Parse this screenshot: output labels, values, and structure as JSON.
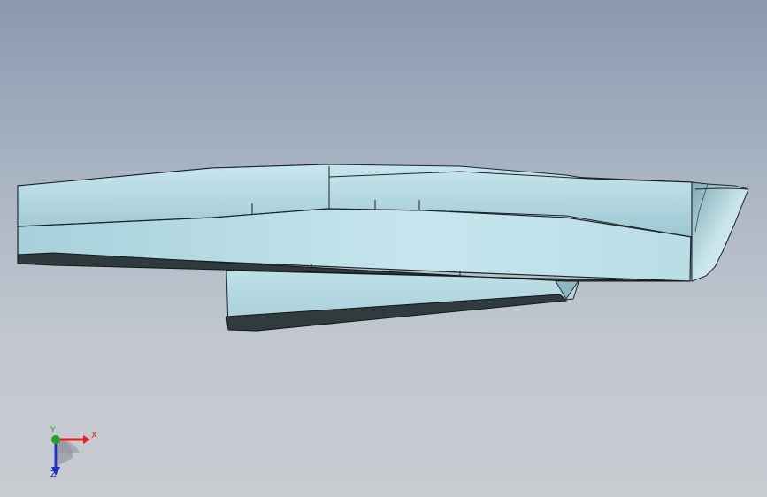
{
  "viewport": {
    "background_top": "#8a99b0",
    "background_bottom": "#c8cbd0"
  },
  "model": {
    "body_color_light": "#d4eef4",
    "body_color_mid": "#a9d2dc",
    "body_color_dark": "#7fa9b4",
    "edge_color": "#1a2326",
    "underside_color": "#2e3a3c"
  },
  "triad": {
    "x_label": "X",
    "y_label": "Y",
    "z_label": "Z",
    "x_color": "#e02020",
    "y_color": "#1fa02a",
    "z_color": "#2030c8",
    "icon": "coordinate-triad-icon"
  }
}
